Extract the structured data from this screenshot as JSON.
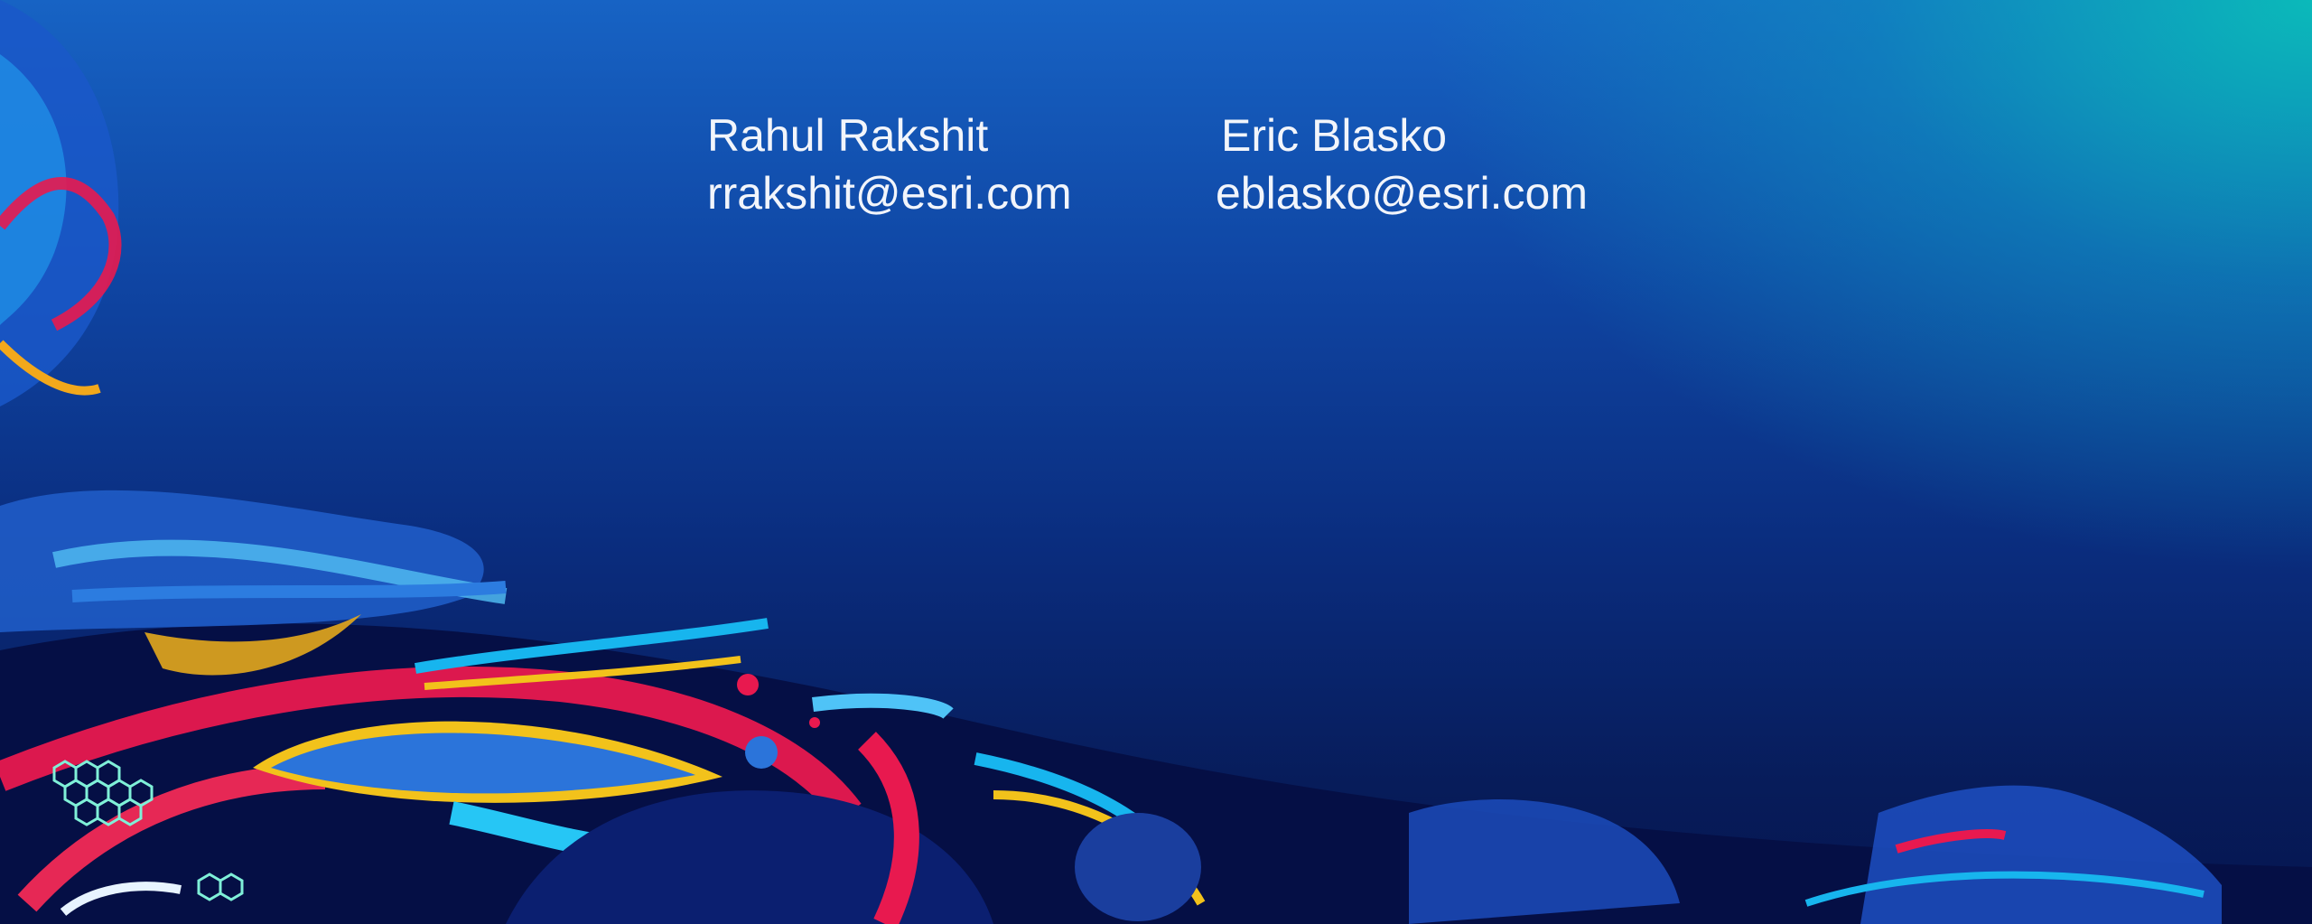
{
  "contacts": [
    {
      "name": "Rahul Rakshit",
      "email": "rrakshit@esri.com"
    },
    {
      "name": "Eric Blasko",
      "email": "eblasko@esri.com"
    }
  ],
  "colors": {
    "background_top": "#1763c4",
    "background_bottom": "#061550",
    "accent_teal": "#0abeb9",
    "accent_red": "#e8194f",
    "accent_yellow": "#f2c21b",
    "accent_cyan": "#17b5ee",
    "text": "#f2f5fb"
  }
}
